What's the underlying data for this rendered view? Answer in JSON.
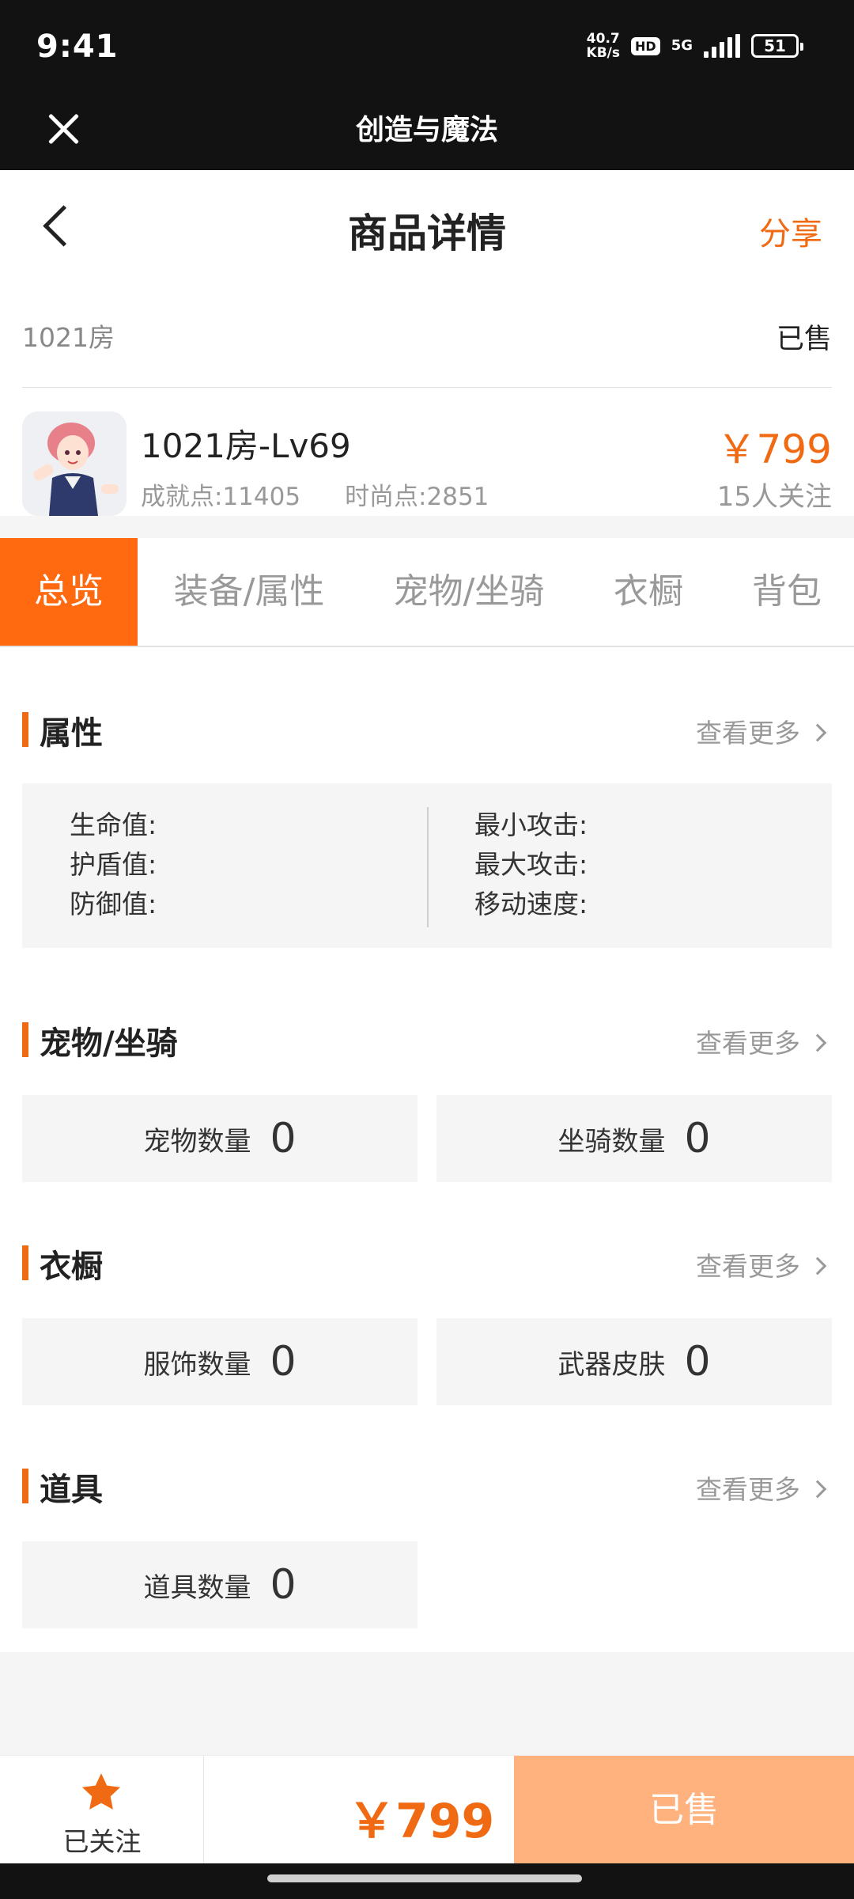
{
  "status_bar": {
    "time": "9:41",
    "speed": "40.7",
    "speed_unit": "KB/s",
    "hd": "HD",
    "network": "5G",
    "battery": "51"
  },
  "app_bar": {
    "title": "创造与魔法"
  },
  "header": {
    "title": "商品详情",
    "share": "分享"
  },
  "room_row": {
    "name": "1021房",
    "status": "已售"
  },
  "product": {
    "name": "1021房-Lv69",
    "achievement": "成就点:11405",
    "fashion": "时尚点:2851",
    "price": "￥799",
    "followers": "15人关注"
  },
  "tabs": [
    "总览",
    "装备/属性",
    "宠物/坐骑",
    "衣橱",
    "背包"
  ],
  "sections": {
    "attributes": {
      "title": "属性",
      "more": "查看更多",
      "left": [
        "生命值:",
        "护盾值:",
        "防御值:"
      ],
      "right": [
        "最小攻击:",
        "最大攻击:",
        "移动速度:"
      ]
    },
    "pets": {
      "title": "宠物/坐骑",
      "more": "查看更多",
      "pet_label": "宠物数量",
      "pet_value": "0",
      "mount_label": "坐骑数量",
      "mount_value": "0"
    },
    "wardrobe": {
      "title": "衣橱",
      "more": "查看更多",
      "clothes_label": "服饰数量",
      "clothes_value": "0",
      "skin_label": "武器皮肤",
      "skin_value": "0"
    },
    "items": {
      "title": "道具",
      "more": "查看更多",
      "items_label": "道具数量",
      "items_value": "0"
    }
  },
  "bottom_bar": {
    "follow_label": "已关注",
    "price": "￥799",
    "sold_label": "已售"
  },
  "colors": {
    "accent": "#f06a13",
    "tab_active": "#ff6a10",
    "sold_button": "#ffb27d"
  },
  "icons": {
    "close": "close-icon",
    "back": "back-arrow-icon",
    "star": "star-icon",
    "chevron": "chevron-right-icon"
  }
}
